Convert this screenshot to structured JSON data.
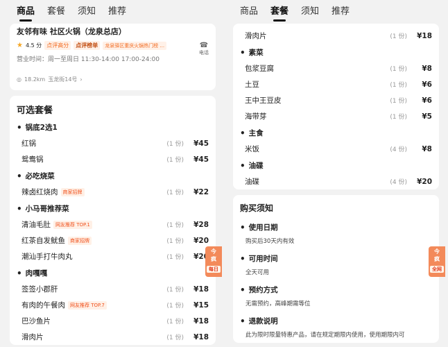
{
  "left": {
    "tabs": [
      "商品",
      "套餐",
      "须知",
      "推荐"
    ],
    "shop": {
      "name": "友邻有味 社区火锅（龙泉总店）",
      "rating": "4.5 分",
      "rating_tag": "点评高分",
      "rank_label": "点评榜单",
      "rank_text": "龙泉驿区重庆火锅热门榜 ...",
      "hours": "营业时间：周一至周日 11:30-14:00 17:00-24:00",
      "phone_label": "电话",
      "distance": "18.2km",
      "address": "玉龙街14号"
    },
    "menu_title": "可选套餐",
    "groups": [
      {
        "name": "锅底2选1",
        "items": [
          {
            "name": "红锅",
            "badge": "",
            "qty": "(1 份)",
            "price": "¥45"
          },
          {
            "name": "鸳鸯锅",
            "badge": "",
            "qty": "(1 份)",
            "price": "¥45"
          }
        ]
      },
      {
        "name": "必吃烧菜",
        "items": [
          {
            "name": "辣卤红烧肉",
            "badge": "商家招牌",
            "qty": "(1 份)",
            "price": "¥22"
          }
        ]
      },
      {
        "name": "小马哥推荐菜",
        "items": [
          {
            "name": "清油毛肚",
            "badge": "网友推荐 TOP.1",
            "qty": "(1 份)",
            "price": "¥28"
          },
          {
            "name": "红茶自发鱿鱼",
            "badge": "商家招牌",
            "qty": "(1 份)",
            "price": "¥20"
          },
          {
            "name": "潮汕手打牛肉丸",
            "badge": "",
            "qty": "(1 份)",
            "price": "¥20"
          }
        ]
      },
      {
        "name": "肉嘎嘎",
        "items": [
          {
            "name": "签签小郡肝",
            "badge": "",
            "qty": "(1 份)",
            "price": "¥18"
          },
          {
            "name": "有肉的午餐肉",
            "badge": "网友推荐 TOP.7",
            "qty": "(1 份)",
            "price": "¥15"
          },
          {
            "name": "巴沙鱼片",
            "badge": "",
            "qty": "(1 份)",
            "price": "¥18"
          },
          {
            "name": "滑肉片",
            "badge": "",
            "qty": "(1 份)",
            "price": "¥18"
          }
        ]
      }
    ],
    "float_top": "今",
    "float_mid": "疯",
    "float_bottom": "每日"
  },
  "right": {
    "tabs": [
      "商品",
      "套餐",
      "须知",
      "推荐"
    ],
    "top_items": [
      {
        "name": "滑肉片",
        "qty": "(1 份)",
        "price": "¥18"
      }
    ],
    "groups": [
      {
        "name": "素菜",
        "items": [
          {
            "name": "包浆豆腐",
            "qty": "(1 份)",
            "price": "¥8"
          },
          {
            "name": "土豆",
            "qty": "(1 份)",
            "price": "¥6"
          },
          {
            "name": "王中王豆皮",
            "qty": "(1 份)",
            "price": "¥6"
          },
          {
            "name": "海带芽",
            "qty": "(1 份)",
            "price": "¥5"
          }
        ]
      },
      {
        "name": "主食",
        "items": [
          {
            "name": "米饭",
            "qty": "(4 份)",
            "price": "¥8"
          }
        ]
      },
      {
        "name": "油碟",
        "items": [
          {
            "name": "油碟",
            "qty": "(4 份)",
            "price": "¥20"
          }
        ]
      }
    ],
    "notice_title": "购买须知",
    "notices": [
      {
        "head": "使用日期",
        "body": "购买后30天内有效"
      },
      {
        "head": "可用时间",
        "body": "全天可用"
      },
      {
        "head": "预约方式",
        "body": "无需预约，高峰期需等位"
      },
      {
        "head": "退款说明",
        "body": "此为限时限量特惠产品，请在规定期限内使用，使用期限内可"
      }
    ],
    "float_top": "今",
    "float_mid": "疯",
    "float_bottom": "全网"
  },
  "colors": {
    "accent": "#f26b21",
    "star": "#f5a623",
    "badge_text": "#f0521e"
  }
}
